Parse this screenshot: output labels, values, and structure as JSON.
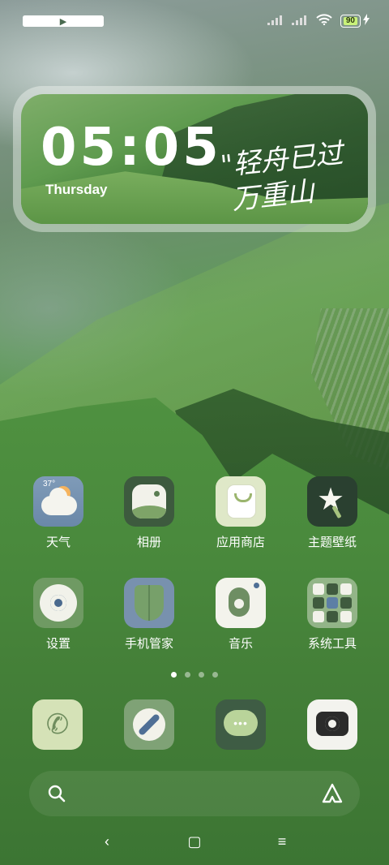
{
  "status_bar": {
    "battery_level": "90",
    "dots": "• •"
  },
  "clock_widget": {
    "time": "05:05",
    "weekday": "Thursday",
    "quote_line1": "\"轻舟已过",
    "quote_line2": "万重山"
  },
  "apps": [
    {
      "label": "天气",
      "icon": "weather-icon",
      "temp": "37°"
    },
    {
      "label": "相册",
      "icon": "gallery-icon"
    },
    {
      "label": "应用商店",
      "icon": "app-store-icon"
    },
    {
      "label": "主题壁纸",
      "icon": "theme-icon"
    },
    {
      "label": "设置",
      "icon": "settings-icon"
    },
    {
      "label": "手机管家",
      "icon": "security-icon"
    },
    {
      "label": "音乐",
      "icon": "music-icon"
    },
    {
      "label": "系统工具",
      "icon": "folder-icon"
    }
  ],
  "page_indicator": {
    "count": 4,
    "active": 0
  },
  "dock": [
    {
      "icon": "phone-icon"
    },
    {
      "icon": "browser-icon"
    },
    {
      "icon": "messages-icon"
    },
    {
      "icon": "camera-icon"
    }
  ],
  "nav": {
    "back": "‹",
    "home": "▢",
    "menu": "≡"
  },
  "colors": {
    "battery": "#c9f27a",
    "wallpaper_green": "#4f9140"
  }
}
